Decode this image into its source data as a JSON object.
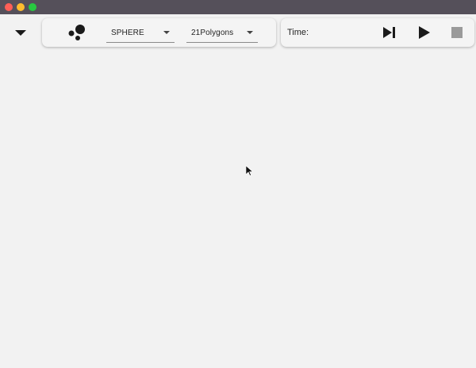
{
  "window": {
    "colors": {
      "titlebar": "#55505a",
      "close": "#ff5f57",
      "minimize": "#febc2e",
      "maximize": "#28c840",
      "canvas": "#f2f2f2"
    }
  },
  "toolbar": {
    "menu_icon": "triangle-down-icon",
    "shape_icon": "spheres-icon",
    "shape_select": {
      "value": "SPHERE"
    },
    "polygon_select": {
      "value": "21Polygons"
    }
  },
  "playback": {
    "time_label": "Time:",
    "step_icon": "step-forward-icon",
    "play_icon": "play-icon",
    "stop_icon": "stop-icon"
  }
}
